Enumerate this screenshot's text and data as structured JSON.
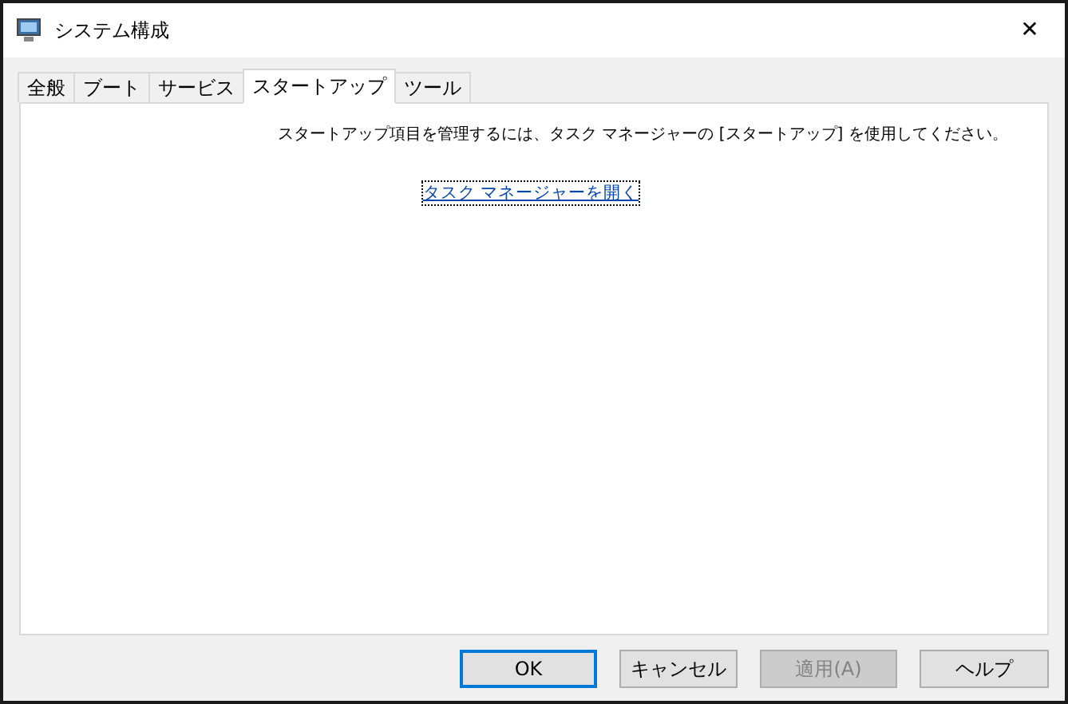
{
  "window": {
    "title": "システム構成",
    "close": "✕"
  },
  "tabs": [
    {
      "label": "全般",
      "selected": false
    },
    {
      "label": "ブート",
      "selected": false
    },
    {
      "label": "サービス",
      "selected": false
    },
    {
      "label": "スタートアップ",
      "selected": true
    },
    {
      "label": "ツール",
      "selected": false
    }
  ],
  "panel": {
    "message": "スタートアップ項目を管理するには、タスク マネージャーの [スタートアップ] を使用してください。",
    "link": "タスク マネージャーを開く"
  },
  "buttons": [
    {
      "label": "OK",
      "default": true,
      "disabled": false
    },
    {
      "label": "キャンセル",
      "default": false,
      "disabled": false
    },
    {
      "label": "適用(A)",
      "default": false,
      "disabled": true
    },
    {
      "label": "ヘルプ",
      "default": false,
      "disabled": false
    }
  ]
}
